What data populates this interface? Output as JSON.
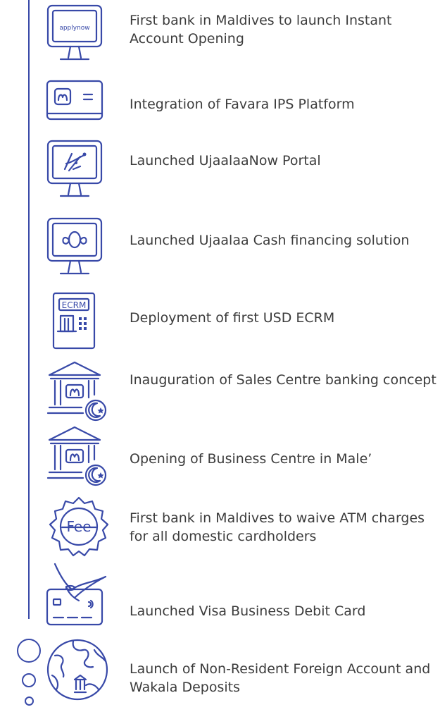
{
  "colors": {
    "accent": "#3849a8",
    "text": "#3c3c3c"
  },
  "milestones": [
    {
      "icon": "monitor-applynow-icon",
      "icon_text": "applynow",
      "label": "First bank in Maldives to launch Instant Account Opening"
    },
    {
      "icon": "payment-terminal-icon",
      "label": "Integration of Favara IPS Platform"
    },
    {
      "icon": "monitor-portal-icon",
      "label": "Launched UjaalaaNow Portal"
    },
    {
      "icon": "monitor-cash-icon",
      "label": "Launched Ujaalaa Cash financing solution"
    },
    {
      "icon": "ecrm-machine-icon",
      "icon_text": "ECRM",
      "label": "Deployment of first USD ECRM"
    },
    {
      "icon": "bank-building-moon-icon",
      "label": "Inauguration of Sales Centre banking concept"
    },
    {
      "icon": "bank-building-moon-icon",
      "label": "Opening of Business Centre in Male’"
    },
    {
      "icon": "fee-badge-icon",
      "icon_text": "Fee",
      "label": "First bank in Maldives to waive ATM charges for all domestic cardholders"
    },
    {
      "icon": "card-manta-icon",
      "label": "Launched Visa Business Debit Card"
    },
    {
      "icon": "globe-bank-icon",
      "label": "Launch of Non-Resident Foreign Account and Wakala Deposits"
    }
  ]
}
